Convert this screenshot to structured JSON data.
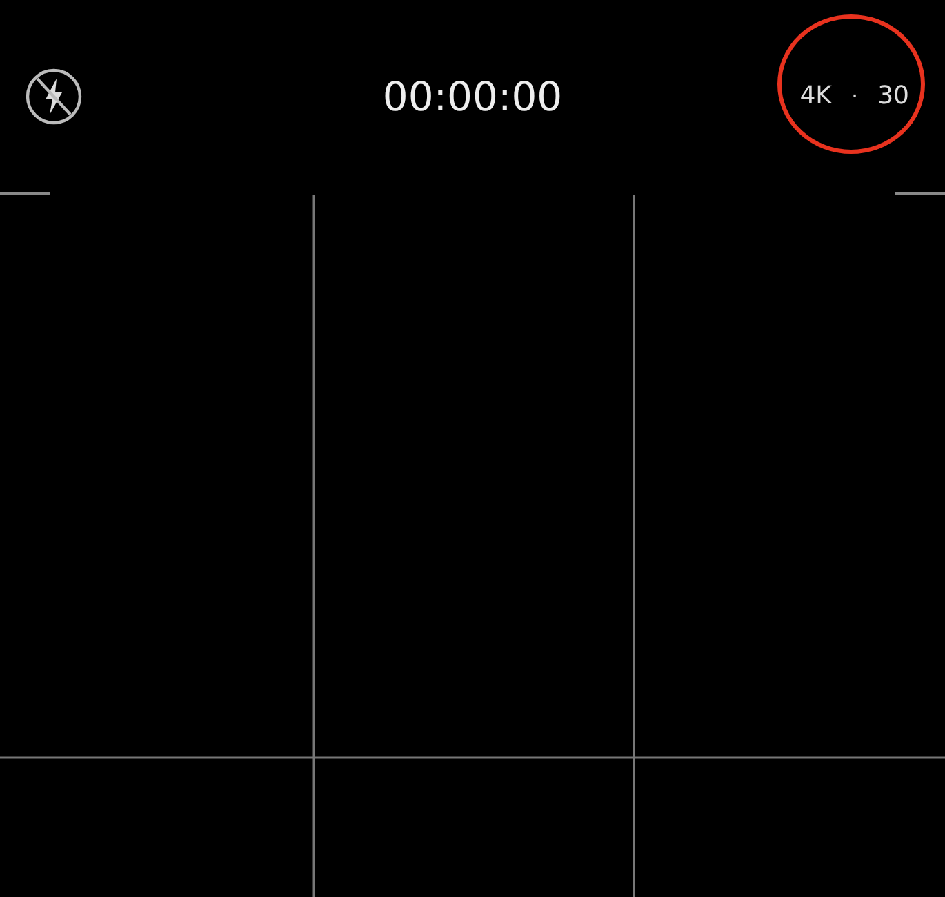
{
  "top_bar": {
    "flash": {
      "on": false
    },
    "timer": "00:00:00",
    "resolution": "4K",
    "separator": "·",
    "frame_rate": "30",
    "highlighted": true
  }
}
